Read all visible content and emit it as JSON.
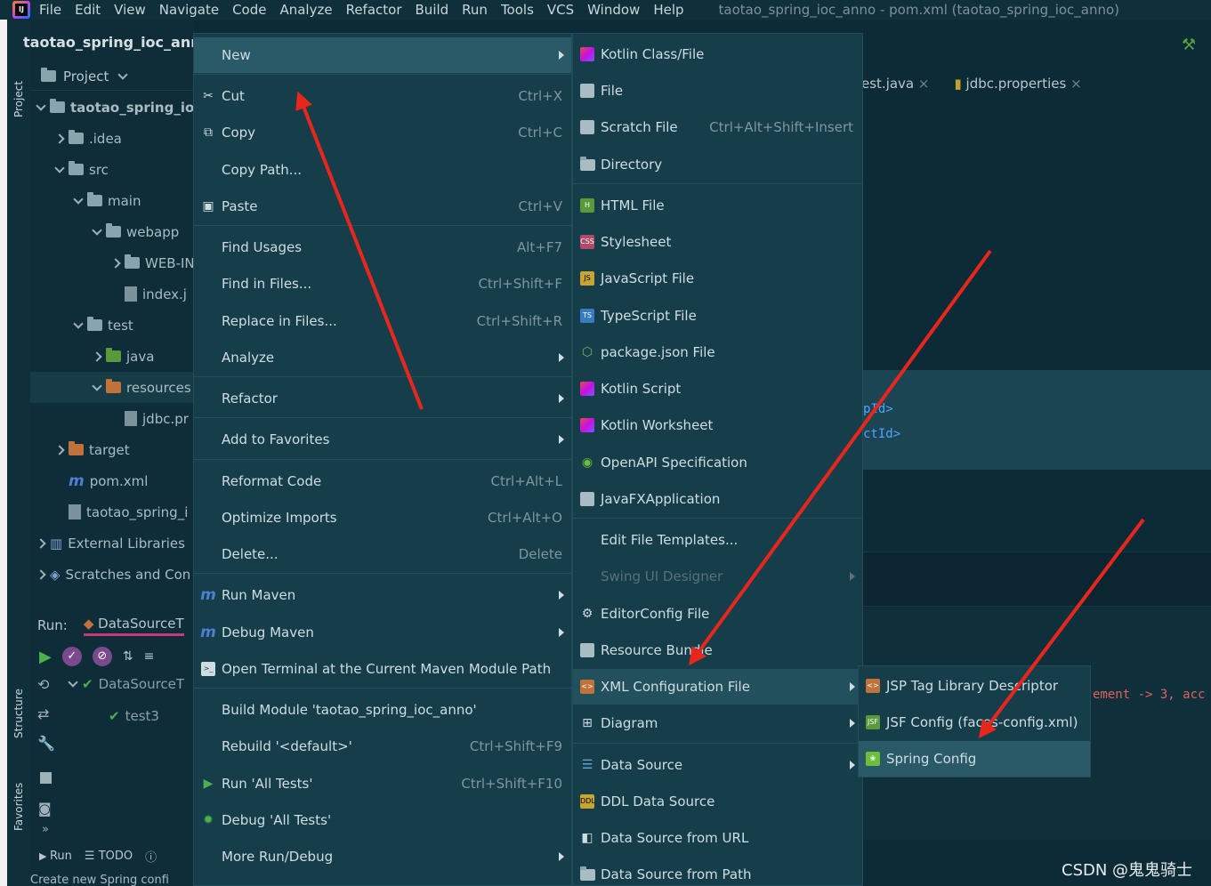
{
  "menubar": {
    "items": [
      "File",
      "Edit",
      "View",
      "Navigate",
      "Code",
      "Analyze",
      "Refactor",
      "Build",
      "Run",
      "Tools",
      "VCS",
      "Window",
      "Help"
    ],
    "window_title": "taotao_spring_ioc_anno - pom.xml (taotao_spring_ioc_anno)"
  },
  "breadcrumb": "taotao_spring_ioc_anno",
  "tool_strip": {
    "project": "Project",
    "structure": "Structure",
    "favorites": "Favorites"
  },
  "project_panel": {
    "title": "Project",
    "tree": [
      {
        "label": "taotao_spring_ioc",
        "depth": 0,
        "bold": true
      },
      {
        "label": ".idea",
        "depth": 1
      },
      {
        "label": "src",
        "depth": 1
      },
      {
        "label": "main",
        "depth": 2
      },
      {
        "label": "webapp",
        "depth": 3
      },
      {
        "label": "WEB-IN",
        "depth": 4
      },
      {
        "label": "index.j",
        "depth": 4
      },
      {
        "label": "test",
        "depth": 2
      },
      {
        "label": "java",
        "depth": 3
      },
      {
        "label": "resources",
        "depth": 3
      },
      {
        "label": "jdbc.pr",
        "depth": 4
      },
      {
        "label": "target",
        "depth": 1
      },
      {
        "label": "pom.xml",
        "depth": 1
      },
      {
        "label": "taotao_spring_i",
        "depth": 1
      },
      {
        "label": "External Libraries",
        "depth": 0
      },
      {
        "label": "Scratches and Con",
        "depth": 0
      }
    ]
  },
  "run_panel": {
    "label": "Run:",
    "tab": "DataSourceT",
    "tree": [
      "DataSourceT",
      "test3"
    ],
    "bottom": [
      "Run",
      "TODO"
    ],
    "status": "Create new Spring confi"
  },
  "editor": {
    "tabs": [
      "est.java",
      "jdbc.properties"
    ],
    "code_lines": [
      "pId>",
      "ctId>"
    ],
    "red_line": "ement -> 3, acc"
  },
  "context_menu": [
    {
      "label": "New",
      "shortcut": "",
      "submenu": true,
      "icon": "none"
    },
    {
      "label": "Cut",
      "shortcut": "Ctrl+X",
      "icon": "scissors-icon"
    },
    {
      "label": "Copy",
      "shortcut": "Ctrl+C",
      "icon": "copy-icon"
    },
    {
      "label": "Copy Path...",
      "shortcut": "",
      "icon": "none"
    },
    {
      "label": "Paste",
      "shortcut": "Ctrl+V",
      "icon": "paste-icon"
    },
    {
      "label": "Find Usages",
      "shortcut": "Alt+F7",
      "icon": "none"
    },
    {
      "label": "Find in Files...",
      "shortcut": "Ctrl+Shift+F",
      "icon": "none"
    },
    {
      "label": "Replace in Files...",
      "shortcut": "Ctrl+Shift+R",
      "icon": "none"
    },
    {
      "label": "Analyze",
      "shortcut": "",
      "submenu": true,
      "icon": "none"
    },
    {
      "label": "Refactor",
      "shortcut": "",
      "submenu": true,
      "icon": "none"
    },
    {
      "label": "Add to Favorites",
      "shortcut": "",
      "submenu": true,
      "icon": "none"
    },
    {
      "label": "Reformat Code",
      "shortcut": "Ctrl+Alt+L",
      "icon": "none"
    },
    {
      "label": "Optimize Imports",
      "shortcut": "Ctrl+Alt+O",
      "icon": "none"
    },
    {
      "label": "Delete...",
      "shortcut": "Delete",
      "icon": "none"
    },
    {
      "label": "Run Maven",
      "shortcut": "",
      "submenu": true,
      "icon": "maven-icon"
    },
    {
      "label": "Debug Maven",
      "shortcut": "",
      "submenu": true,
      "icon": "maven-debug-icon"
    },
    {
      "label": "Open Terminal at the Current Maven Module Path",
      "shortcut": "",
      "icon": "terminal-icon"
    },
    {
      "label": "Build Module 'taotao_spring_ioc_anno'",
      "shortcut": "",
      "icon": "none"
    },
    {
      "label": "Rebuild '<default>'",
      "shortcut": "Ctrl+Shift+F9",
      "icon": "none"
    },
    {
      "label": "Run 'All Tests'",
      "shortcut": "Ctrl+Shift+F10",
      "icon": "run-icon"
    },
    {
      "label": "Debug 'All Tests'",
      "shortcut": "",
      "icon": "debug-icon"
    },
    {
      "label": "More Run/Debug",
      "shortcut": "",
      "submenu": true,
      "icon": "none"
    }
  ],
  "new_submenu": [
    {
      "label": "Kotlin Class/File",
      "shortcut": "",
      "icon": "kotlin-file-icon"
    },
    {
      "label": "File",
      "shortcut": "",
      "icon": "file-icon"
    },
    {
      "label": "Scratch File",
      "shortcut": "Ctrl+Alt+Shift+Insert",
      "icon": "scratch-file-icon"
    },
    {
      "label": "Directory",
      "shortcut": "",
      "icon": "folder-icon"
    },
    {
      "label": "HTML File",
      "shortcut": "",
      "icon": "html-file-icon"
    },
    {
      "label": "Stylesheet",
      "shortcut": "",
      "icon": "css-file-icon"
    },
    {
      "label": "JavaScript File",
      "shortcut": "",
      "icon": "js-file-icon"
    },
    {
      "label": "TypeScript File",
      "shortcut": "",
      "icon": "ts-file-icon"
    },
    {
      "label": "package.json File",
      "shortcut": "",
      "icon": "package-json-icon"
    },
    {
      "label": "Kotlin Script",
      "shortcut": "",
      "icon": "kotlin-script-icon"
    },
    {
      "label": "Kotlin Worksheet",
      "shortcut": "",
      "icon": "kotlin-worksheet-icon"
    },
    {
      "label": "OpenAPI Specification",
      "shortcut": "",
      "icon": "openapi-icon"
    },
    {
      "label": "JavaFXApplication",
      "shortcut": "",
      "icon": "javafx-icon"
    },
    {
      "label": "Edit File Templates...",
      "shortcut": "",
      "icon": "none"
    },
    {
      "label": "Swing UI Designer",
      "shortcut": "",
      "icon": "none",
      "disabled": true,
      "submenu": true
    },
    {
      "label": "EditorConfig File",
      "shortcut": "",
      "icon": "gear-icon"
    },
    {
      "label": "Resource Bundle",
      "shortcut": "",
      "icon": "resource-bundle-icon"
    },
    {
      "label": "XML Configuration File",
      "shortcut": "",
      "icon": "xml-file-icon",
      "submenu": true
    },
    {
      "label": "Diagram",
      "shortcut": "",
      "icon": "diagram-icon",
      "submenu": true
    },
    {
      "label": "Data Source",
      "shortcut": "",
      "icon": "database-icon",
      "submenu": true
    },
    {
      "label": "DDL Data Source",
      "shortcut": "",
      "icon": "ddl-icon"
    },
    {
      "label": "Data Source from URL",
      "shortcut": "",
      "icon": "url-icon"
    },
    {
      "label": "Data Source from Path",
      "shortcut": "",
      "icon": "folder-icon"
    }
  ],
  "xml_submenu": [
    {
      "label": "JSP Tag Library Descriptor",
      "icon": "jsp-tld-icon"
    },
    {
      "label": "JSF Config (faces-config.xml)",
      "icon": "jsf-icon"
    },
    {
      "label": "Spring Config",
      "icon": "spring-icon"
    }
  ],
  "watermark": "CSDN @鬼鬼骑士",
  "colors": {
    "accent_red": "#e8261c",
    "menu_bg": "#163e4a",
    "selection": "#2a5a67"
  }
}
